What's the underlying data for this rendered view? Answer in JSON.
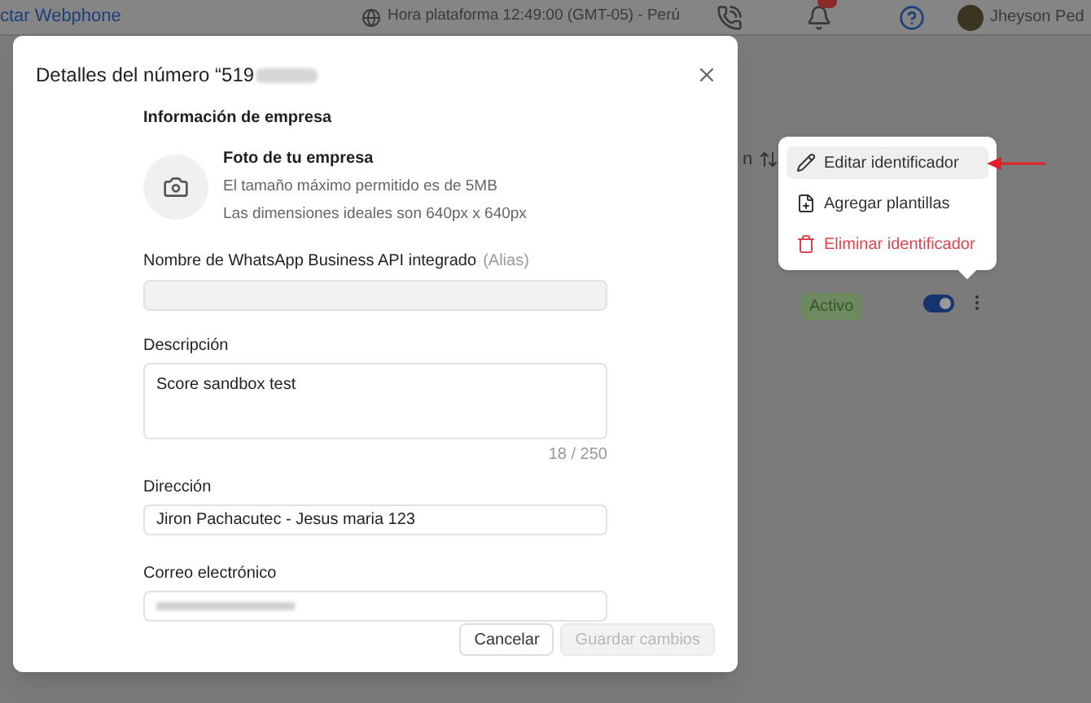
{
  "top_bar": {
    "webphone_link": "ctar Webphone",
    "clock": "Hora plataforma 12:49:00 (GMT-05) - Perú",
    "user_name": "Jheyson Ped"
  },
  "table": {
    "column_header": "n",
    "row": {
      "status": "Activo",
      "enabled": true
    }
  },
  "modal": {
    "title": "Detalles del número “519",
    "section_title": "Información de empresa",
    "photo": {
      "title": "Foto de tu empresa",
      "hint_1": "El tamaño máximo permitido es de 5MB",
      "hint_2": "Las dimensiones ideales son 640px x 640px"
    },
    "alias": {
      "label": "Nombre de WhatsApp Business API integrado",
      "label_note": "(Alias)",
      "disabled": true
    },
    "description": {
      "label": "Descripción",
      "value": "Score sandbox test",
      "counter": "18 / 250"
    },
    "address": {
      "label": "Dirección",
      "value": "Jiron Pachacutec - Jesus maria 123"
    },
    "email": {
      "label": "Correo electrónico"
    },
    "buttons": [
      {
        "label": "Cancelar",
        "disabled": false
      },
      {
        "label": "Guardar cambios",
        "disabled": true
      }
    ]
  },
  "context_menu": [
    {
      "label": "Editar identificador",
      "kind": "edit",
      "selected": true,
      "danger": false
    },
    {
      "label": "Agregar plantillas",
      "kind": "template",
      "selected": false,
      "danger": false
    },
    {
      "label": "Eliminar identificador",
      "kind": "delete",
      "selected": false,
      "danger": true
    }
  ]
}
